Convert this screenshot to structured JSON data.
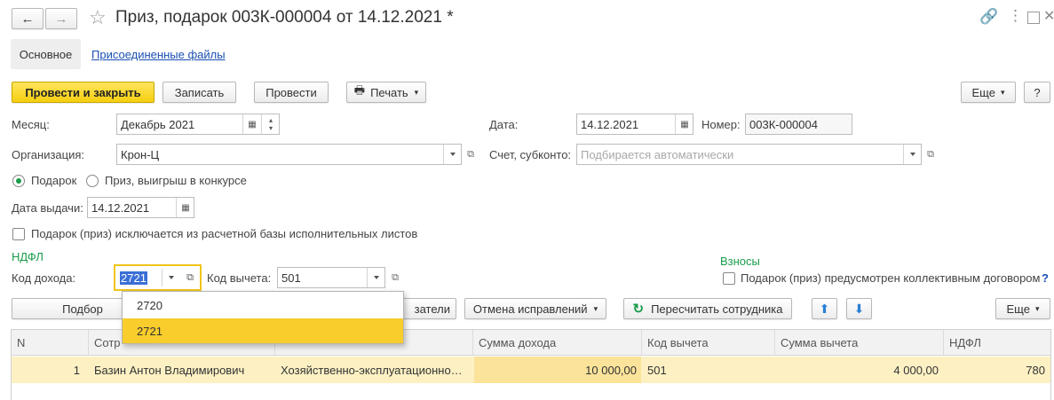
{
  "titlebar": {
    "title": "Приз, подарок 003К-000004 от 14.12.2021 *"
  },
  "tabs": [
    {
      "label": "Основное"
    },
    {
      "label": "Присоединенные файлы"
    }
  ],
  "toolbar": {
    "post_close": "Провести и закрыть",
    "save": "Записать",
    "post": "Провести",
    "print": "Печать",
    "more": "Еще",
    "help": "?"
  },
  "form": {
    "month_label": "Месяц:",
    "month_value": "Декабрь 2021",
    "date_label": "Дата:",
    "date_value": "14.12.2021",
    "number_label": "Номер:",
    "number_value": "003К-000004",
    "org_label": "Организация:",
    "org_value": "Крон-Ц",
    "account_label": "Счет, субконто:",
    "account_placeholder": "Подбирается автоматически",
    "radio_gift": "Подарок",
    "radio_prize": "Приз, выигрыш в конкурсе",
    "issue_date_label": "Дата выдачи:",
    "issue_date_value": "14.12.2021",
    "exclude_label": "Подарок (приз) исключается из расчетной базы исполнительных листов",
    "ndfl_section": "НДФЛ",
    "income_code_label": "Код дохода:",
    "income_code_value": "2721",
    "deduction_code_label": "Код вычета:",
    "deduction_code_value": "501",
    "contrib_section": "Взносы",
    "collective_label": "Подарок (приз) предусмотрен коллективным договором",
    "collective_help": "?"
  },
  "dropdown": {
    "options": [
      "2720",
      "2721"
    ],
    "selected": "2721"
  },
  "table_toolbar": {
    "pick": "Подбор",
    "partial": "затели",
    "cancel_fix": "Отмена исправлений",
    "recalc": "Пересчитать сотрудника",
    "more": "Еще"
  },
  "table": {
    "columns": [
      "N",
      "Сотр",
      "",
      "Сумма дохода",
      "Код вычета",
      "Сумма вычета",
      "НДФЛ"
    ],
    "rows": [
      {
        "n": "1",
        "employee": "Базин Антон Владимирович",
        "income_type": "Хозяйственно-эксплуатационно…",
        "income_sum": "10 000,00",
        "deduction_code": "501",
        "deduction_sum": "4 000,00",
        "ndfl": "780"
      }
    ]
  },
  "colors": {
    "accent_yellow": "#f5cf10",
    "section_green": "#1a9c4b",
    "link_blue": "#1a4fb3",
    "row_highlight": "#fdf1c4"
  }
}
